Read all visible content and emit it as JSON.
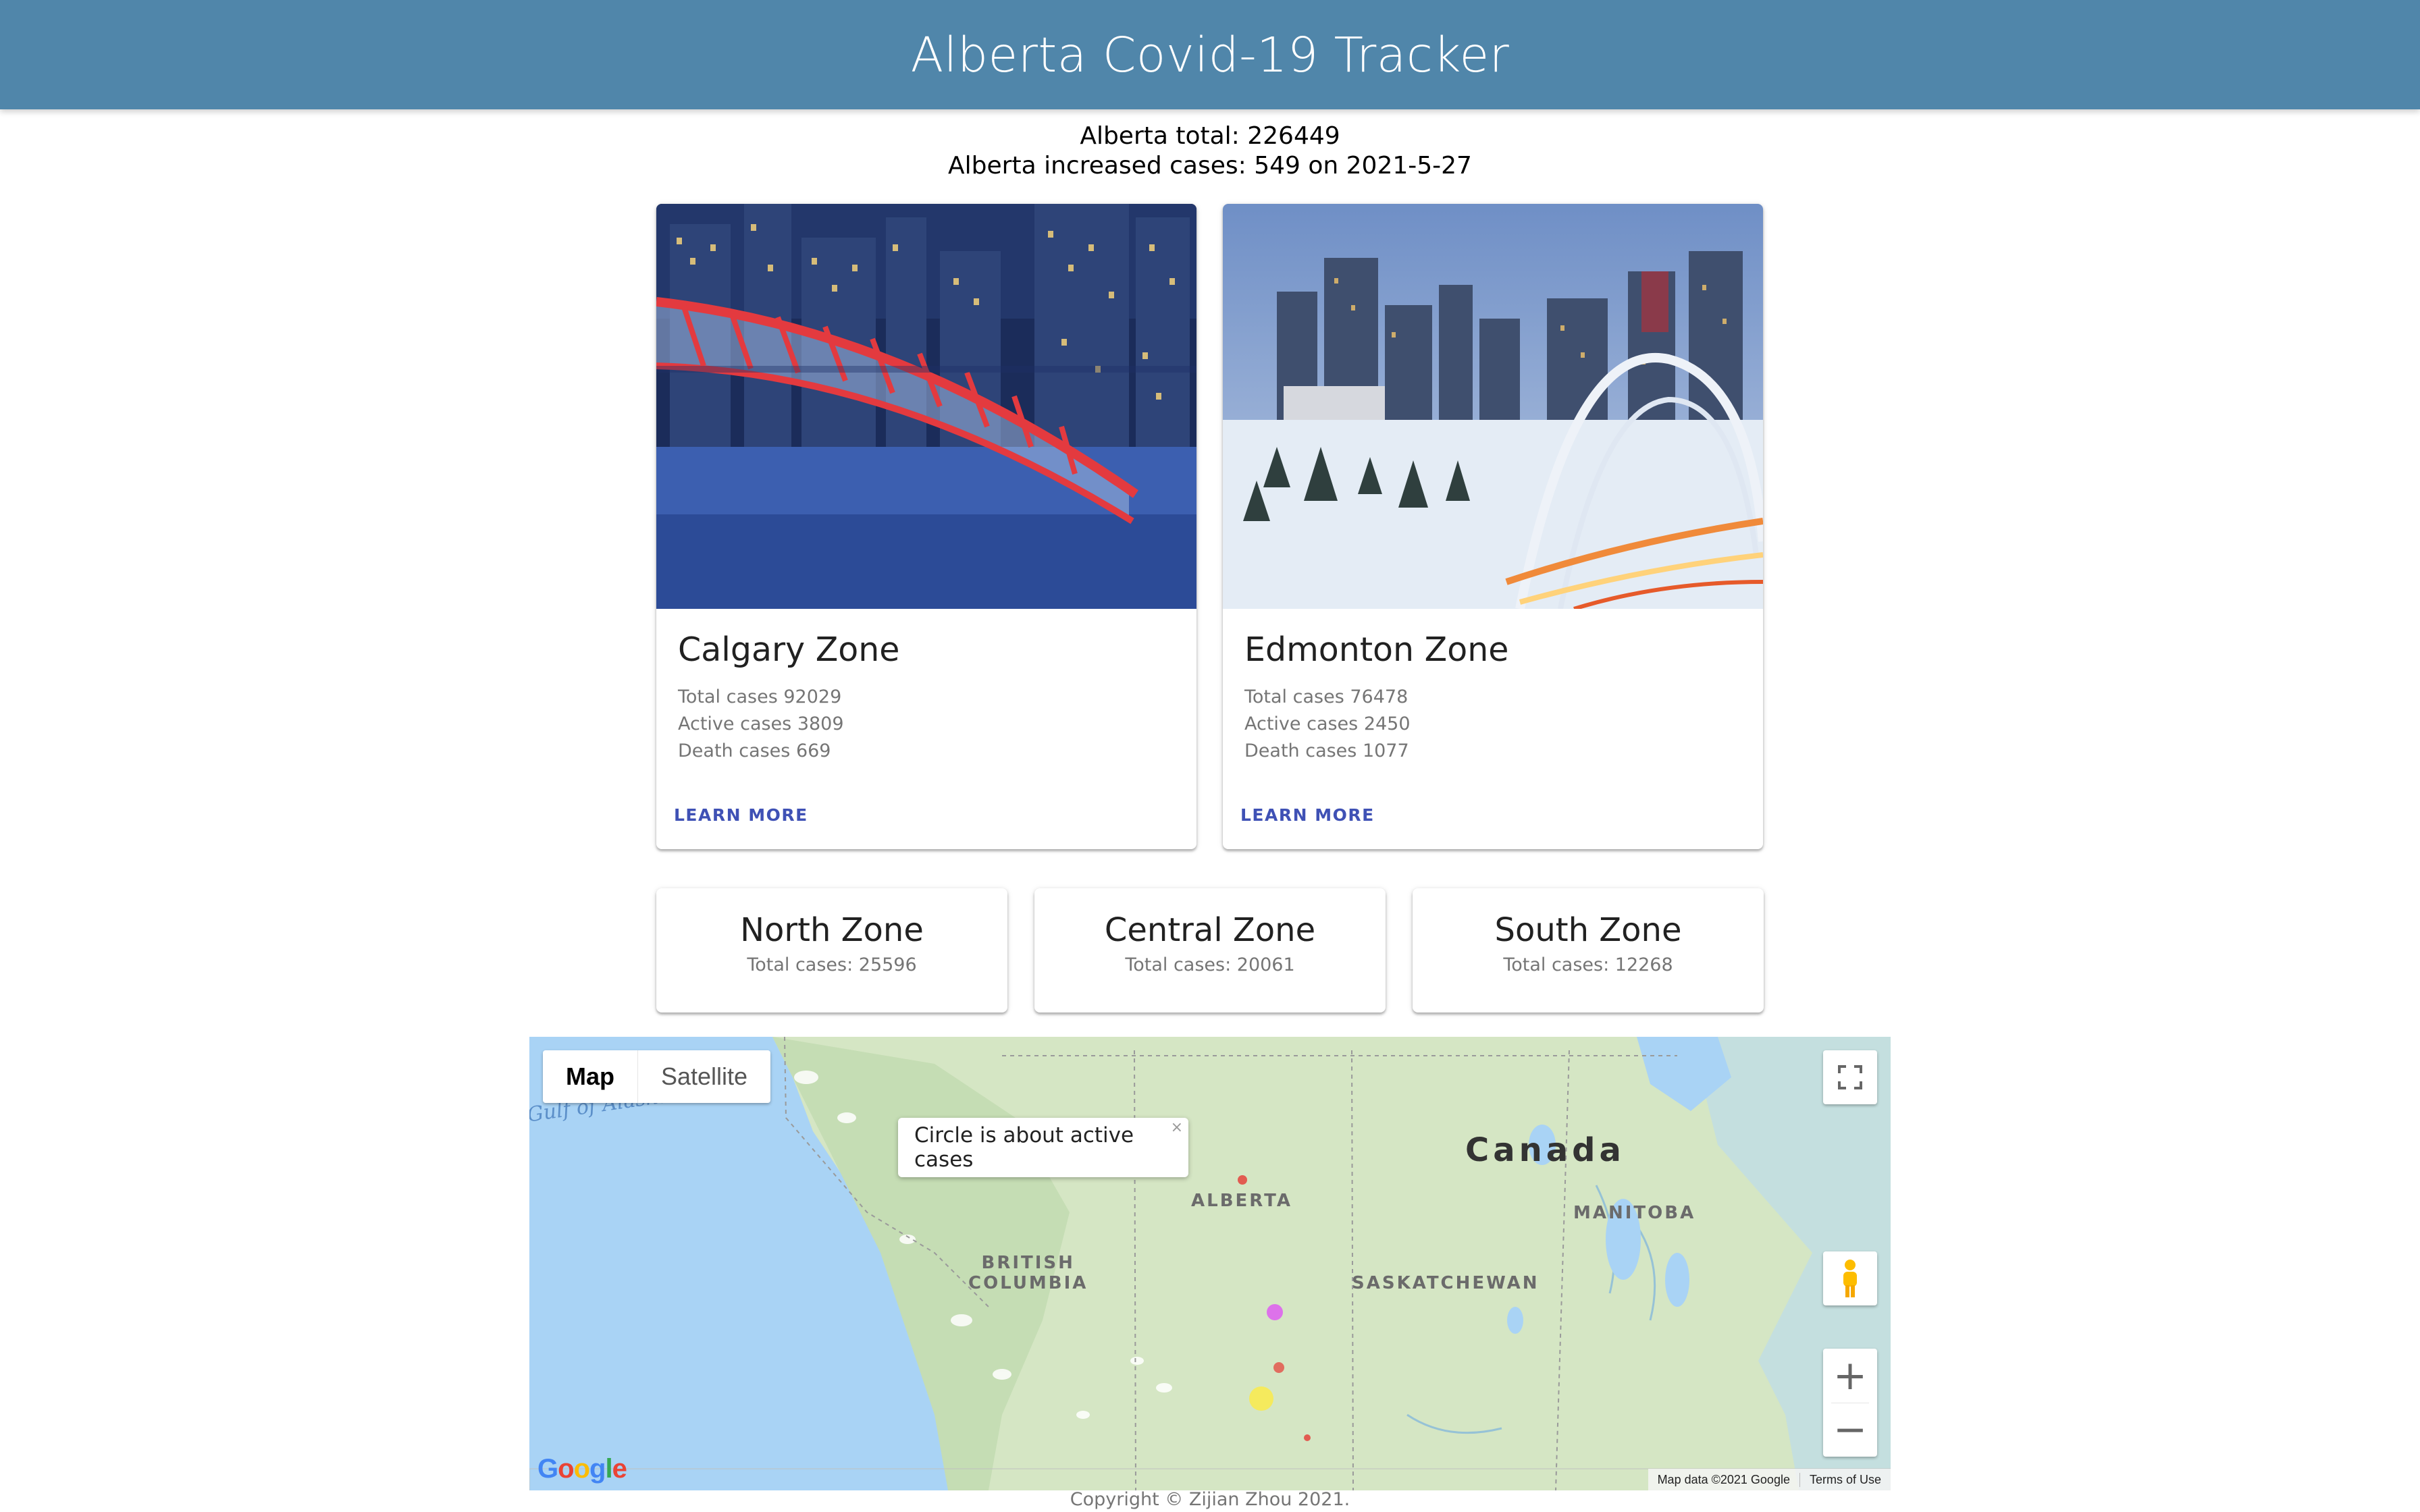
{
  "header": {
    "title": "Alberta Covid-19 Tracker"
  },
  "summary": {
    "total": "Alberta total: 226449",
    "increase": "Alberta increased cases: 549 on 2021-5-27"
  },
  "zones_main": [
    {
      "title": "Calgary Zone",
      "total": "Total cases 92029",
      "active": "Active cases 3809",
      "death": "Death cases 669",
      "action": "LEARN MORE"
    },
    {
      "title": "Edmonton Zone",
      "total": "Total cases 76478",
      "active": "Active cases 2450",
      "death": "Death cases 1077",
      "action": "LEARN MORE"
    }
  ],
  "zones_other": [
    {
      "title": "North Zone",
      "sub": "Total cases: 25596"
    },
    {
      "title": "Central Zone",
      "sub": "Total cases: 20061"
    },
    {
      "title": "South Zone",
      "sub": "Total cases: 12268"
    }
  ],
  "map": {
    "type_map": "Map",
    "type_satellite": "Satellite",
    "info": "Circle is about active cases",
    "info_close": "×",
    "country": "Canada",
    "water": "Gulf of Alaska",
    "labels": {
      "alberta": "ALBERTA",
      "bc": "BRITISH\nCOLUMBIA",
      "sask": "SASKATCHEWAN",
      "manitoba": "MANITOBA"
    },
    "google": "Google",
    "attribution": "Map data ©2021 Google",
    "terms": "Terms of Use",
    "zoom_in": "+",
    "zoom_out": "−",
    "colors": {
      "water": "#a9d3f5",
      "land": "#d7e8c6",
      "edmonton_marker": "#e040fb",
      "calgary_marker": "#ffeb3b",
      "other_marker": "#e53935"
    }
  },
  "footer": {
    "text": "Copyright © Zijian Zhou 2021."
  }
}
